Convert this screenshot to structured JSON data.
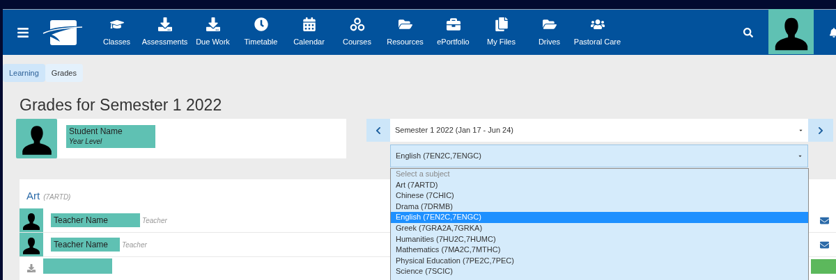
{
  "nav": {
    "items": [
      {
        "label": "Classes"
      },
      {
        "label": "Assessments"
      },
      {
        "label": "Due Work"
      },
      {
        "label": "Timetable"
      },
      {
        "label": "Calendar"
      },
      {
        "label": "Courses"
      },
      {
        "label": "Resources"
      },
      {
        "label": "ePortfolio"
      },
      {
        "label": "My Files"
      },
      {
        "label": "Drives"
      },
      {
        "label": "Pastoral Care"
      }
    ]
  },
  "breadcrumb": [
    {
      "label": "Learning",
      "selected": false
    },
    {
      "label": "Grades",
      "selected": true
    }
  ],
  "page_title": "Grades for Semester 1 2022",
  "student": {
    "name": "Student Name",
    "year_level": "Year Level"
  },
  "semester_select": {
    "value": "Semester 1 2022 (Jan 17 - Jun 24)"
  },
  "subject_select": {
    "value": "English (7EN2C,7ENGC)",
    "expanded": true,
    "prompt_option": "Select a subject",
    "options": [
      {
        "label": "Art (7ARTD)",
        "selected": false
      },
      {
        "label": "Chinese (7CHIC)",
        "selected": false
      },
      {
        "label": "Drama (7DRMB)",
        "selected": false
      },
      {
        "label": "English (7EN2C,7ENGC)",
        "selected": true
      },
      {
        "label": "Greek (7GRA2A,7GRKA)",
        "selected": false
      },
      {
        "label": "Humanities (7HU2C,7HUMC)",
        "selected": false
      },
      {
        "label": "Mathematics (7MA2C,7MTHC)",
        "selected": false
      },
      {
        "label": "Physical Education (7PE2C,7PEC)",
        "selected": false
      },
      {
        "label": "Science (7SCIC)",
        "selected": false
      }
    ]
  },
  "subject_card": {
    "title": "Art",
    "code": "(7ARTD)",
    "teachers": [
      {
        "name": "Teacher Name",
        "role": "Teacher"
      },
      {
        "name": "Teacher Name",
        "role": "Teacher"
      }
    ]
  }
}
